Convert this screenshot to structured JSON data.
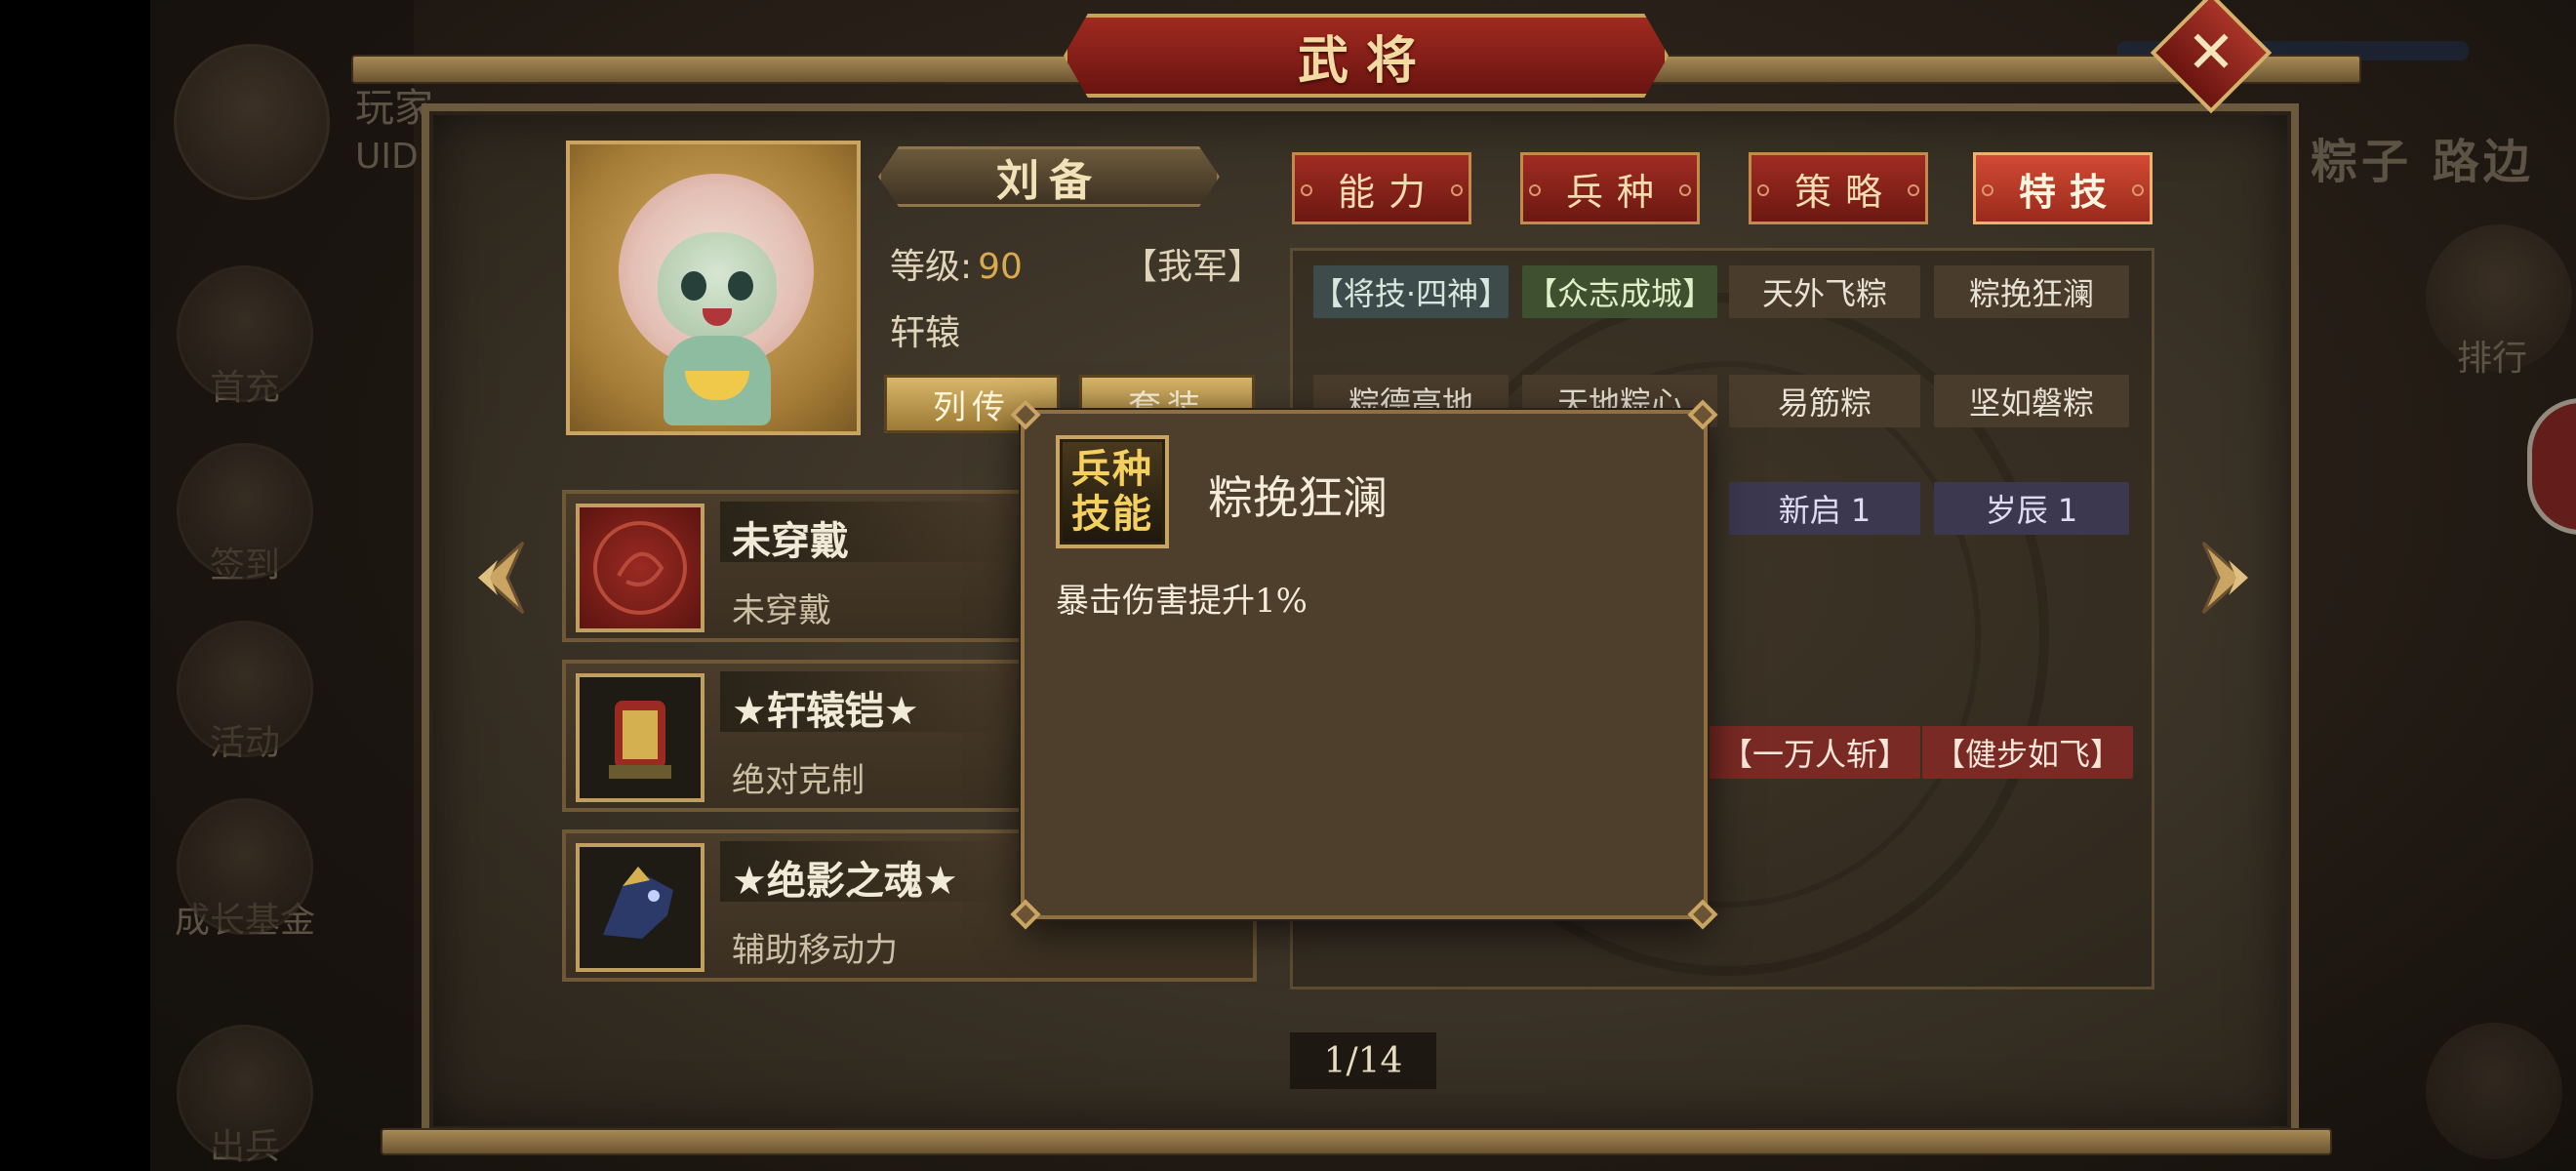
{
  "background": {
    "player_label": "玩家",
    "uid_label": "UID",
    "right_title": "粽子 路边",
    "side_menu": [
      "首充",
      "签到",
      "活动",
      "成长基金",
      "出兵"
    ],
    "rank_label": "排行"
  },
  "dialog": {
    "title": "武将",
    "close_symbol": "✕"
  },
  "hero": {
    "name": "刘备",
    "level_label": "等级:",
    "level_value": "90",
    "army": "【我军】",
    "faction": "轩辕",
    "biography_button": "列传",
    "outfit_button": "套装"
  },
  "equipment": [
    {
      "name": "未穿戴",
      "desc": "未穿戴"
    },
    {
      "name": "★轩辕铠★",
      "desc": "绝对克制"
    },
    {
      "name": "★绝影之魂★",
      "desc": "辅助移动力"
    }
  ],
  "tabs": [
    {
      "label": "能力",
      "active": false
    },
    {
      "label": "兵种",
      "active": false
    },
    {
      "label": "策略",
      "active": false
    },
    {
      "label": "特技",
      "active": true
    }
  ],
  "skills": {
    "row1": [
      "【将技·四神】",
      "【众志成城】",
      "天外飞粽",
      "粽挽狂澜"
    ],
    "row2": [
      "粽德高地",
      "天地粽心",
      "易筋粽",
      "坚如磐粽"
    ],
    "row3": [
      "新启 1",
      "岁辰 1"
    ],
    "row4": [
      "【一万人斩】",
      "【健步如飞】"
    ]
  },
  "pager": {
    "text": "1/14"
  },
  "popup": {
    "badge_line1": "兵种",
    "badge_line2": "技能",
    "title": "粽挽狂澜",
    "description": "暴击伤害提升1%"
  },
  "colors": {
    "accent_red": "#a02c22",
    "gold": "#c9a462",
    "level_value": "#d9aa4e"
  }
}
